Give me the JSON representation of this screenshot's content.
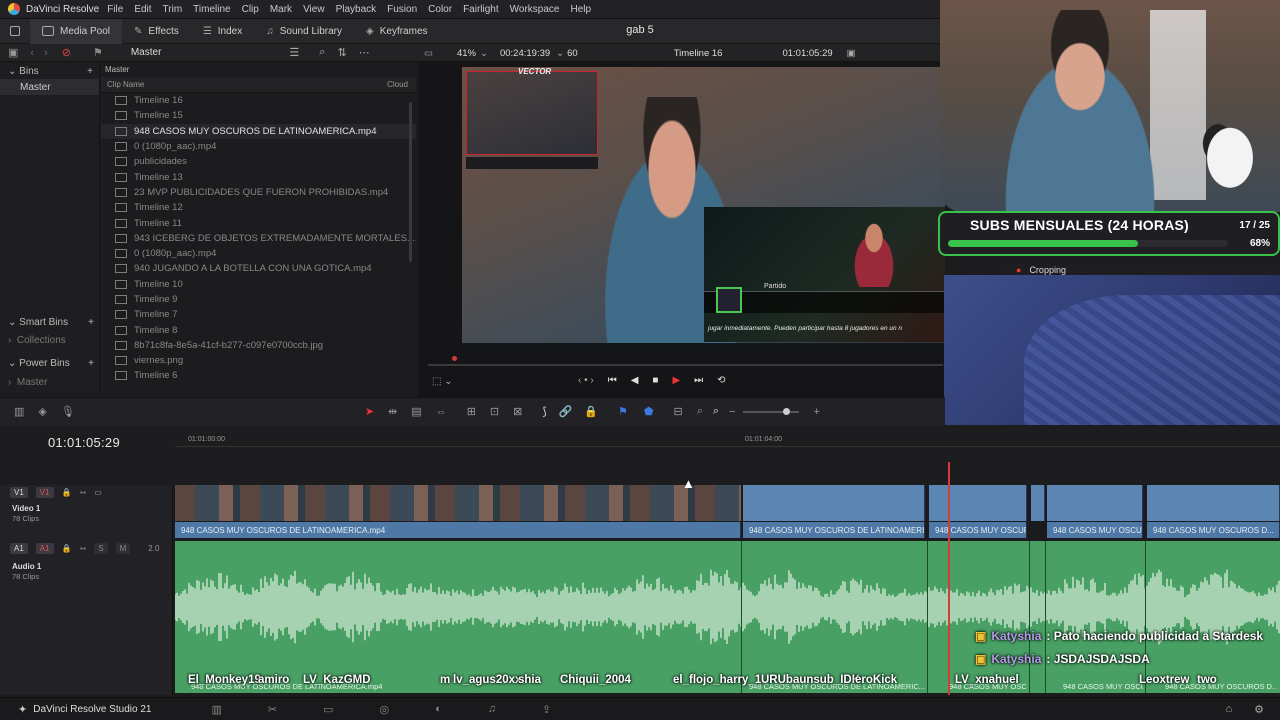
{
  "menubar": {
    "app_name": "DaVinci Resolve",
    "items": [
      "File",
      "Edit",
      "Trim",
      "Timeline",
      "Clip",
      "Mark",
      "View",
      "Playback",
      "Fusion",
      "Color",
      "Fairlight",
      "Workspace",
      "Help"
    ]
  },
  "toolbar": {
    "media_pool": "Media Pool",
    "effects": "Effects",
    "index": "Index",
    "sound_library": "Sound Library",
    "keyframes": "Keyframes",
    "project_name": "gab 5"
  },
  "subbar": {
    "master_label": "Master"
  },
  "viewerbar": {
    "zoom": "41%",
    "duration": "00:24:19:39",
    "fps": "60",
    "timeline_name": "Timeline 16",
    "timecode": "01:01:05:29"
  },
  "bins": {
    "header": "Bins",
    "master": "Master",
    "smart_bins": "Smart Bins",
    "collections": "Collections",
    "power_bins": "Power Bins",
    "power_master": "Master"
  },
  "cliplist": {
    "path": "Master",
    "col_name": "Clip Name",
    "col_cloud": "Cloud",
    "items": [
      "Timeline 16",
      "Timeline 15",
      "948 CASOS MUY OSCUROS DE LATINOAMERICA.mp4",
      "0 (1080p_aac).mp4",
      "publicidades",
      "Timeline 13",
      "23 MVP PUBLICIDADES QUE FUERON PROHIBIDAS.mp4",
      "Timeline 12",
      "Timeline 11",
      "943 ICEBERG DE OBJETOS EXTREMADAMENTE MORTALES....",
      "0 (1080p_aac).mp4",
      "940 JUGANDO A LA BOTELLA CON UNA GOTICA.mp4",
      "Timeline 10",
      "Timeline 9",
      "Timeline 7",
      "Timeline 8",
      "8b71c8fa-8e5a-41cf-b277-c097e0700ccb.jpg",
      "viernes.png",
      "Timeline 6"
    ],
    "selected_index": 2
  },
  "viewer": {
    "inset_label": "VECTOR",
    "game_menu_label": "Partido",
    "caption": "jugar inmediatamente. Pueden participar hasta 8 jugadores en un n"
  },
  "overlay": {
    "subs_title": "SUBS MENSUALES (24 HORAS)",
    "subs_count": "17 / 25",
    "subs_percent": "68%",
    "subs_progress": 0.68,
    "cropping_label": "Cropping"
  },
  "timeline": {
    "timecode": "01:01:05:29",
    "ruler_marks": [
      "01:01:00:00",
      "01:01:04:00"
    ],
    "video_track": {
      "badge": "V1",
      "badge2": "V1",
      "name": "Video 1",
      "clips": "78 Clips"
    },
    "audio_track": {
      "badge": "A1",
      "badge2": "A1",
      "name": "Audio 1",
      "clips": "78 Clips",
      "volume": "2.0"
    },
    "video_clip_labels": [
      "948 CASOS MUY OSCUROS DE LATINOAMERICA.mp4",
      "948 CASOS MUY OSCUROS DE LATINOAMERIC...",
      "948 CASOS MUY OSCURO...",
      "948 CASOS MUY OSCUR...",
      "948 CASOS MUY OSCUROS D..."
    ],
    "audio_clip_labels": [
      "948 CASOS MUY OSCUROS DE LATINOAMERICA.mp4",
      "948 CASOS MUY OSCUROS DE LATINOAMERIC...",
      "948 CASOS MUY OSCURO...",
      "948 CASOS MUY OSCUR...",
      "948 CASOS MUY OSCUROS D..."
    ]
  },
  "chat": [
    {
      "name": "Katyshia",
      "message": ": Pato haciendo publicidad a Stardesk"
    },
    {
      "name": "Katyshia",
      "message": ": JSDAJSDAJSDA"
    }
  ],
  "viewers": [
    "El_Monkey19",
    "amiro",
    "LV_KazGMD",
    "m",
    "lv_agus20xx",
    "shia",
    "Chiquii_2004",
    "el_flojo_harry_1",
    "URUbaunsub_IDK",
    "eroKick",
    "LV_xnahuel",
    "Leoxtrew",
    "two"
  ],
  "footer": {
    "app_label": "DaVinci Resolve Studio 21"
  },
  "colors": {
    "audio_green": "#48a064",
    "video_blue": "#5b86b4",
    "accent_red": "#d43b3b",
    "subs_green": "#39c24a"
  }
}
